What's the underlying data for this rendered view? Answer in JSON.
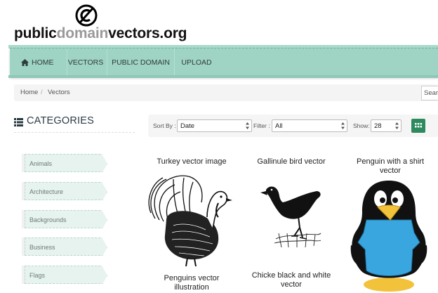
{
  "site": {
    "logo_parts": [
      "public",
      "domain",
      "vectors.org"
    ]
  },
  "nav": {
    "home": "HOME",
    "vectors": "VECTORS",
    "public_domain": "PUBLIC DOMAIN",
    "upload": "UPLOAD"
  },
  "breadcrumb": {
    "home": "Home",
    "separator": "/",
    "current": "Vectors"
  },
  "search": {
    "placeholder": "Sear"
  },
  "categories": {
    "title": "CATEGORIES",
    "items": [
      "Animals",
      "Architecture",
      "Backgrounds",
      "Business",
      "Flags"
    ]
  },
  "toolbar": {
    "sort_label": "Sort By :",
    "sort_value": "Date",
    "filter_label": "Filter :",
    "filter_value": "All",
    "show_label": "Show:",
    "show_value": "28"
  },
  "vectors": [
    {
      "title": "Turkey vector image"
    },
    {
      "title": "Gallinule bird vector"
    },
    {
      "title": "Penguin with a shirt vector"
    },
    {
      "title": "Penguins vector illustration"
    },
    {
      "title": "Chicke black and white vector"
    }
  ],
  "colors": {
    "nav_bg": "#9fd3c4",
    "grid_button": "#2d8a5e",
    "category_bg": "#e7f3ee",
    "penguin_shirt": "#3aa6e0"
  }
}
